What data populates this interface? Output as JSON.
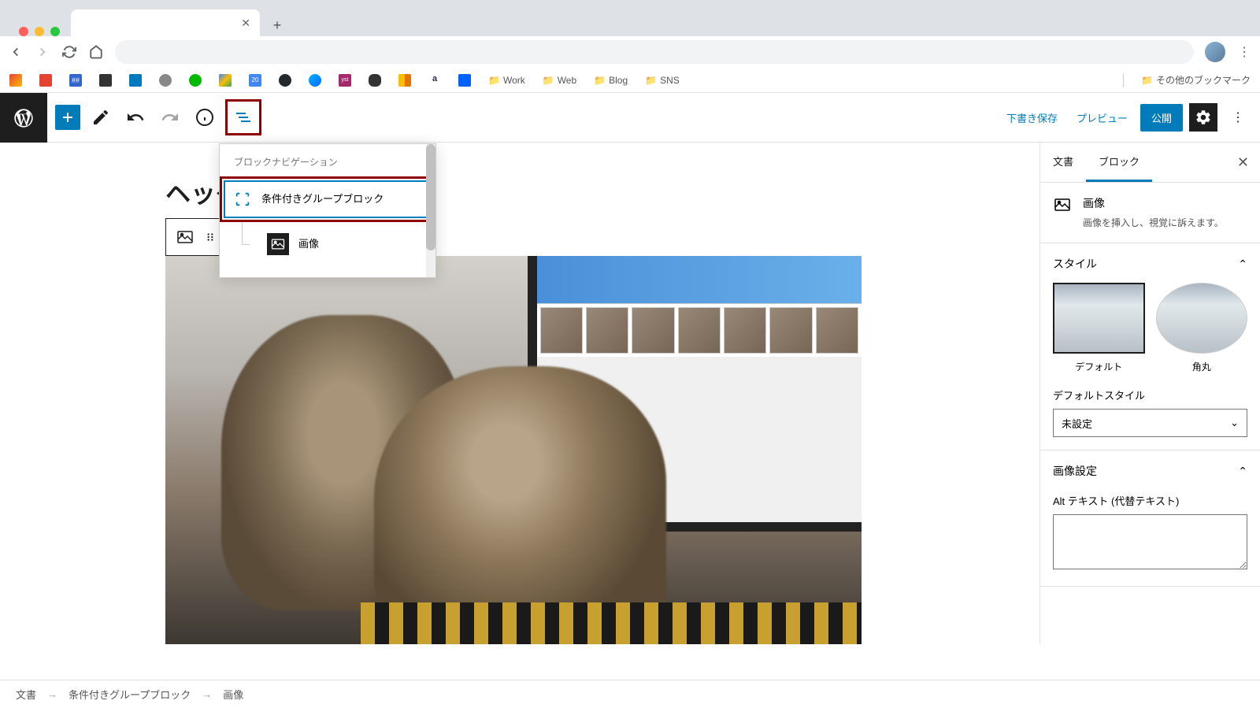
{
  "browser": {
    "tab_title": "",
    "bookmarks_folders": [
      "Work",
      "Web",
      "Blog",
      "SNS"
    ],
    "other_bookmarks": "その他のブックマーク"
  },
  "header": {
    "save_draft": "下書き保存",
    "preview": "プレビュー",
    "publish": "公開"
  },
  "nav_popup": {
    "title": "ブロックナビゲーション",
    "item1": "条件付きグループブロック",
    "item2": "画像"
  },
  "content": {
    "title": "ヘッダーメディ"
  },
  "sidebar": {
    "tab_doc": "文書",
    "tab_block": "ブロック",
    "block_name": "画像",
    "block_desc": "画像を挿入し、視覚に訴えます。",
    "panel_style": "スタイル",
    "style_default": "デフォルト",
    "style_round": "角丸",
    "default_style_label": "デフォルトスタイル",
    "default_style_value": "未設定",
    "panel_settings": "画像設定",
    "alt_label": "Alt テキスト (代替テキスト)"
  },
  "breadcrumb": {
    "b1": "文書",
    "b2": "条件付きグループブロック",
    "b3": "画像"
  }
}
